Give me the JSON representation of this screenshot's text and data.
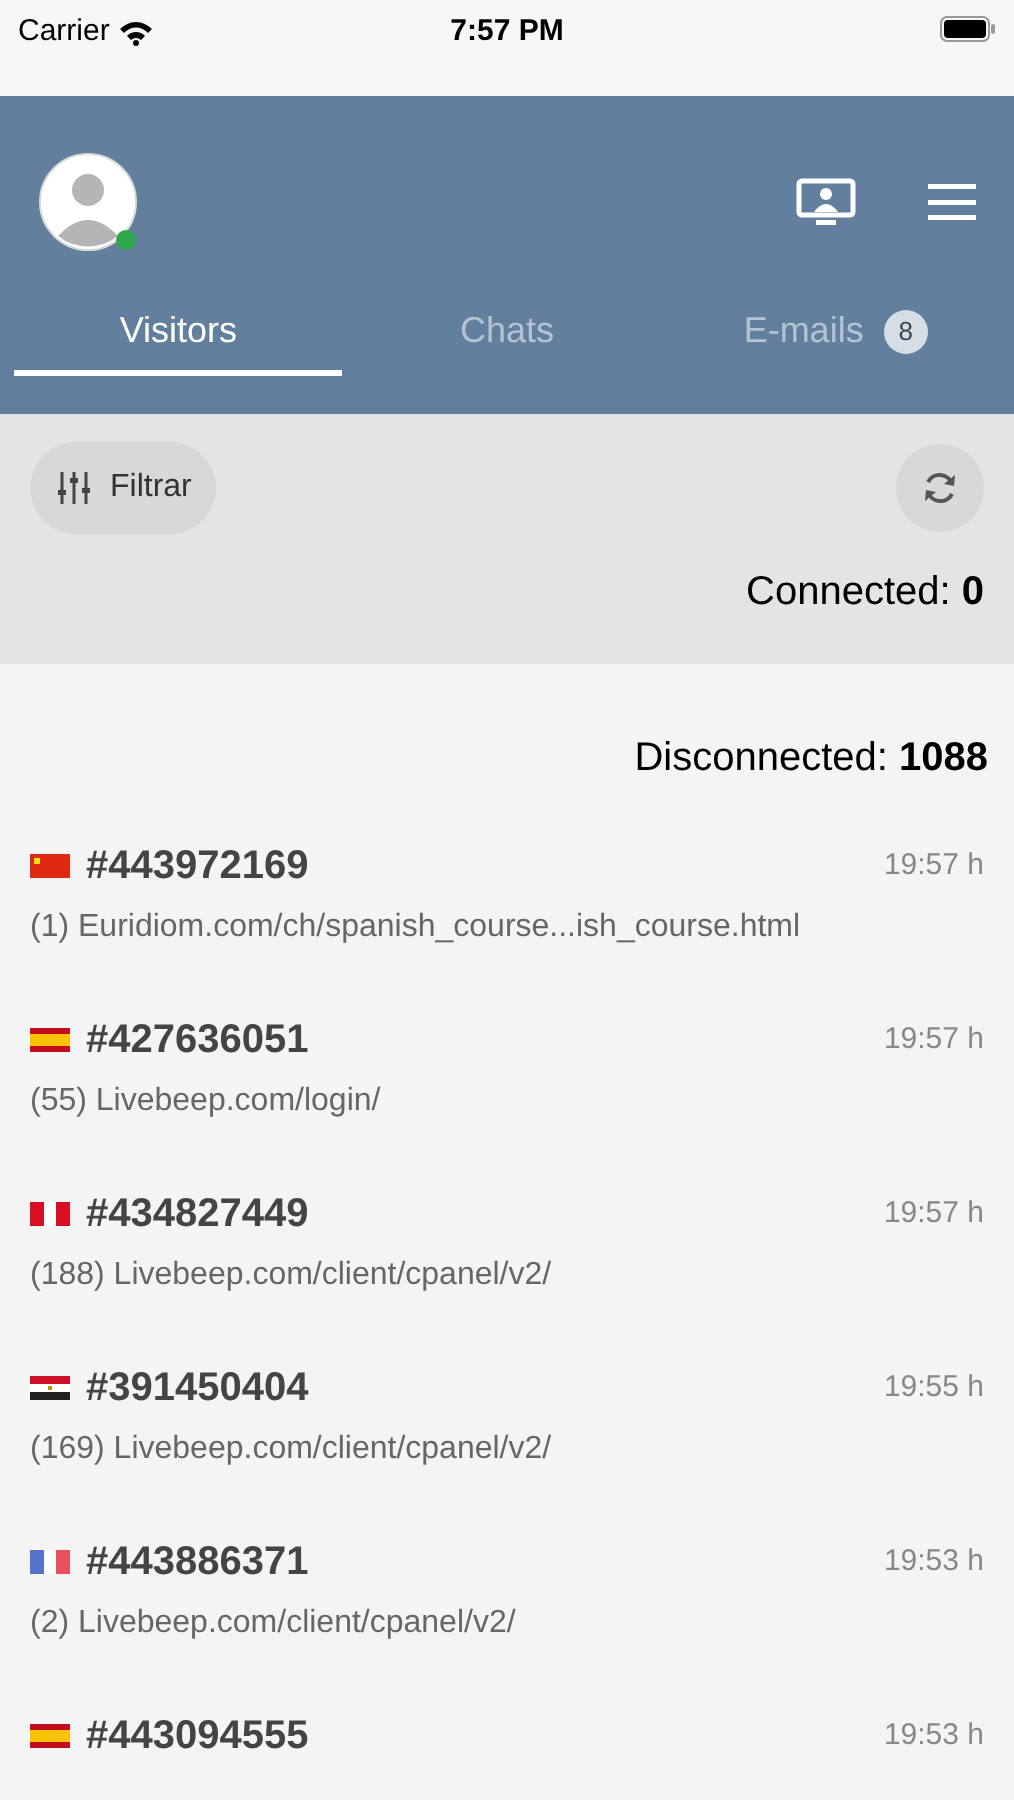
{
  "status_bar": {
    "carrier": "Carrier",
    "time": "7:57 PM"
  },
  "header": {
    "agent": {
      "online": true
    }
  },
  "tabs": [
    {
      "label": "Visitors",
      "selected": true
    },
    {
      "label": "Chats",
      "selected": false
    },
    {
      "label": "E-mails",
      "selected": false,
      "badge": "8"
    }
  ],
  "toolbar": {
    "filter_label": "Filtrar"
  },
  "connected": {
    "label": "Connected:",
    "count": "0"
  },
  "disconnected": {
    "label": "Disconnected:",
    "count": "1088"
  },
  "visitors": [
    {
      "kind": "cn",
      "id": "#443972169",
      "time": "19:57 h",
      "page": "(1) Euridiom.com/ch/spanish_course...ish_course.html"
    },
    {
      "kind": "es",
      "id": "#427636051",
      "time": "19:57 h",
      "page": "(55) Livebeep.com/login/"
    },
    {
      "kind": "pe",
      "id": "#434827449",
      "time": "19:57 h",
      "page": "(188) Livebeep.com/client/cpanel/v2/"
    },
    {
      "kind": "eg",
      "id": "#391450404",
      "time": "19:55 h",
      "page": "(169) Livebeep.com/client/cpanel/v2/"
    },
    {
      "kind": "fr",
      "id": "#443886371",
      "time": "19:53 h",
      "page": "(2) Livebeep.com/client/cpanel/v2/"
    },
    {
      "kind": "es",
      "id": "#443094555",
      "time": "19:53 h"
    }
  ]
}
